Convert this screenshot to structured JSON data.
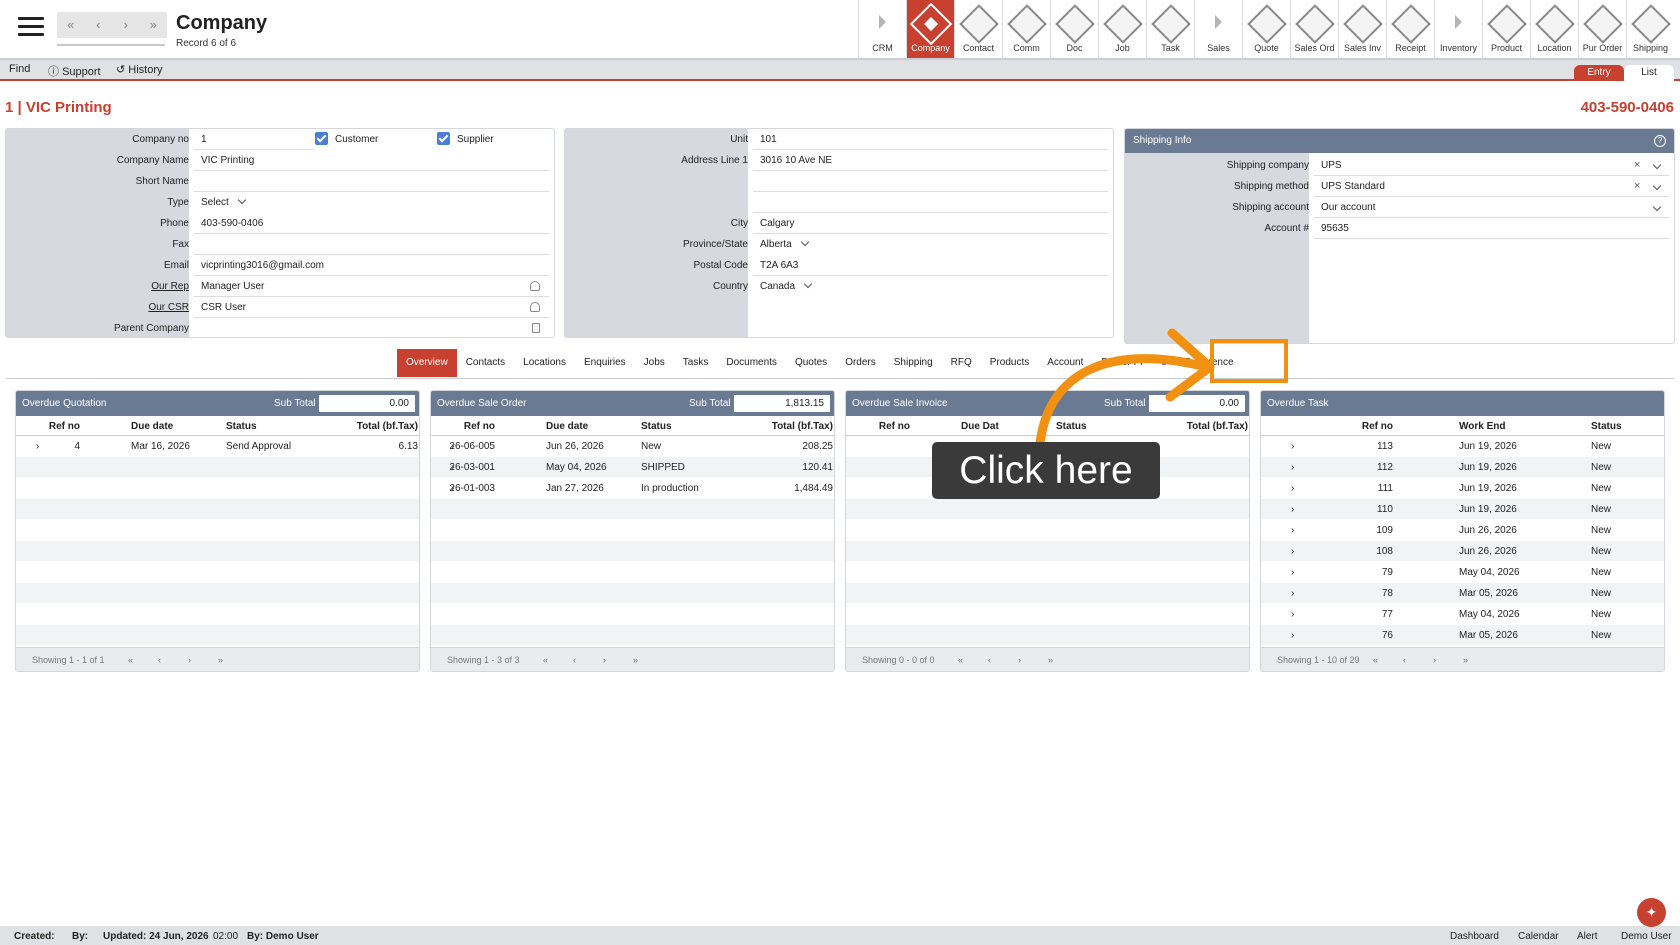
{
  "header": {
    "title": "Company",
    "record": "Record 6 of 6"
  },
  "nav": [
    "«",
    "‹",
    "›",
    "»"
  ],
  "modules": [
    "CRM",
    "Company",
    "Contact",
    "Comm",
    "Doc",
    "Job",
    "Task",
    "Sales",
    "Quote",
    "Sales Ord",
    "Sales Inv",
    "Receipt",
    "Inventory",
    "Product",
    "Location",
    "Pur Order",
    "Shipping"
  ],
  "secbar": {
    "find": "Find",
    "support": "Support",
    "history": "History",
    "entry": "Entry",
    "list": "List"
  },
  "record_title": "1 | VIC Printing",
  "record_phone": "403-590-0406",
  "company": {
    "company_no_label": "Company no",
    "company_no": "1",
    "customer_label": "Customer",
    "supplier_label": "Supplier",
    "name_label": "Company Name",
    "name": "VIC Printing",
    "short_label": "Short Name",
    "short": "",
    "type_label": "Type",
    "type": "Select",
    "phone_label": "Phone",
    "phone": "403-590-0406",
    "fax_label": "Fax",
    "fax": "",
    "email_label": "Email",
    "email": "vicprinting3016@gmail.com",
    "rep_label": "Our Rep",
    "rep": "Manager User",
    "csr_label": "Our CSR",
    "csr": "CSR User",
    "parent_label": "Parent Company",
    "parent": ""
  },
  "address": {
    "unit_label": "Unit",
    "unit": "101",
    "line1_label": "Address Line 1",
    "line1": "3016 10 Ave NE",
    "city_label": "City",
    "city": "Calgary",
    "prov_label": "Province/State",
    "prov": "Alberta",
    "postal_label": "Postal Code",
    "postal": "T2A 6A3",
    "country_label": "Country",
    "country": "Canada"
  },
  "shipping": {
    "title": "Shipping Info",
    "company_label": "Shipping company",
    "company": "UPS",
    "method_label": "Shipping method",
    "method": "UPS Standard",
    "account_label": "Shipping account",
    "account": "Our account",
    "acctno_label": "Account #",
    "acctno": "95635"
  },
  "tabs": [
    "Overview",
    "Contacts",
    "Locations",
    "Enquiries",
    "Jobs",
    "Tasks",
    "Documents",
    "Quotes",
    "Orders",
    "Shipping",
    "RFQ",
    "Products",
    "Account",
    "Dealer Pr",
    "s",
    "Preference"
  ],
  "grids": [
    {
      "title": "Overdue Quotation",
      "subtotal_label": "Sub Total",
      "subtotal": "0.00",
      "cols": [
        "Ref no",
        "Due date",
        "Status",
        "Total (bf.Tax)"
      ],
      "rows": [
        [
          "4",
          "Mar 16, 2026",
          "Send Approval",
          "6.13"
        ]
      ],
      "footer": "Showing 1 - 1 of 1"
    },
    {
      "title": "Overdue Sale Order",
      "subtotal_label": "Sub Total",
      "subtotal": "1,813.15",
      "cols": [
        "Ref no",
        "Due date",
        "Status",
        "Total (bf.Tax)"
      ],
      "rows": [
        [
          "26-06-005",
          "Jun 26, 2026",
          "New",
          "208.25"
        ],
        [
          "26-03-001",
          "May 04, 2026",
          "SHIPPED",
          "120.41"
        ],
        [
          "26-01-003",
          "Jan 27, 2026",
          "In production",
          "1,484.49"
        ]
      ],
      "footer": "Showing 1 - 3 of 3"
    },
    {
      "title": "Overdue Sale Invoice",
      "subtotal_label": "Sub Total",
      "subtotal": "0.00",
      "cols": [
        "Ref no",
        "Due Dat",
        "Status",
        "Total (bf.Tax)"
      ],
      "rows": [],
      "footer": "Showing 0 - 0 of 0"
    },
    {
      "title": "Overdue Task",
      "subtotal_label": "",
      "subtotal": "",
      "cols": [
        "Ref no",
        "Work End",
        "Status"
      ],
      "rows": [
        [
          "113",
          "Jun 19, 2026",
          "New"
        ],
        [
          "112",
          "Jun 19, 2026",
          "New"
        ],
        [
          "111",
          "Jun 19, 2026",
          "New"
        ],
        [
          "110",
          "Jun 19, 2026",
          "New"
        ],
        [
          "109",
          "Jun 26, 2026",
          "New"
        ],
        [
          "108",
          "Jun 26, 2026",
          "New"
        ],
        [
          "79",
          "May 04, 2026",
          "New"
        ],
        [
          "78",
          "Mar 05, 2026",
          "New"
        ],
        [
          "77",
          "May 04, 2026",
          "New"
        ],
        [
          "76",
          "Mar 05, 2026",
          "New"
        ]
      ],
      "footer": "Showing 1 - 10 of 29"
    }
  ],
  "pager": [
    "«",
    "‹",
    "›",
    "»"
  ],
  "callout": "Click here",
  "status": {
    "created": "Created:",
    "by": "By:",
    "updated": "Updated: 24 Jun, 2026",
    "time": "02:00",
    "updated_by": "By: Demo User",
    "dashboard": "Dashboard",
    "calendar": "Calendar",
    "alert": "Alert",
    "user": "Demo User"
  },
  "colors": {
    "accent": "#c8402f",
    "header": "#6b7a93",
    "highlight": "#f29111"
  }
}
